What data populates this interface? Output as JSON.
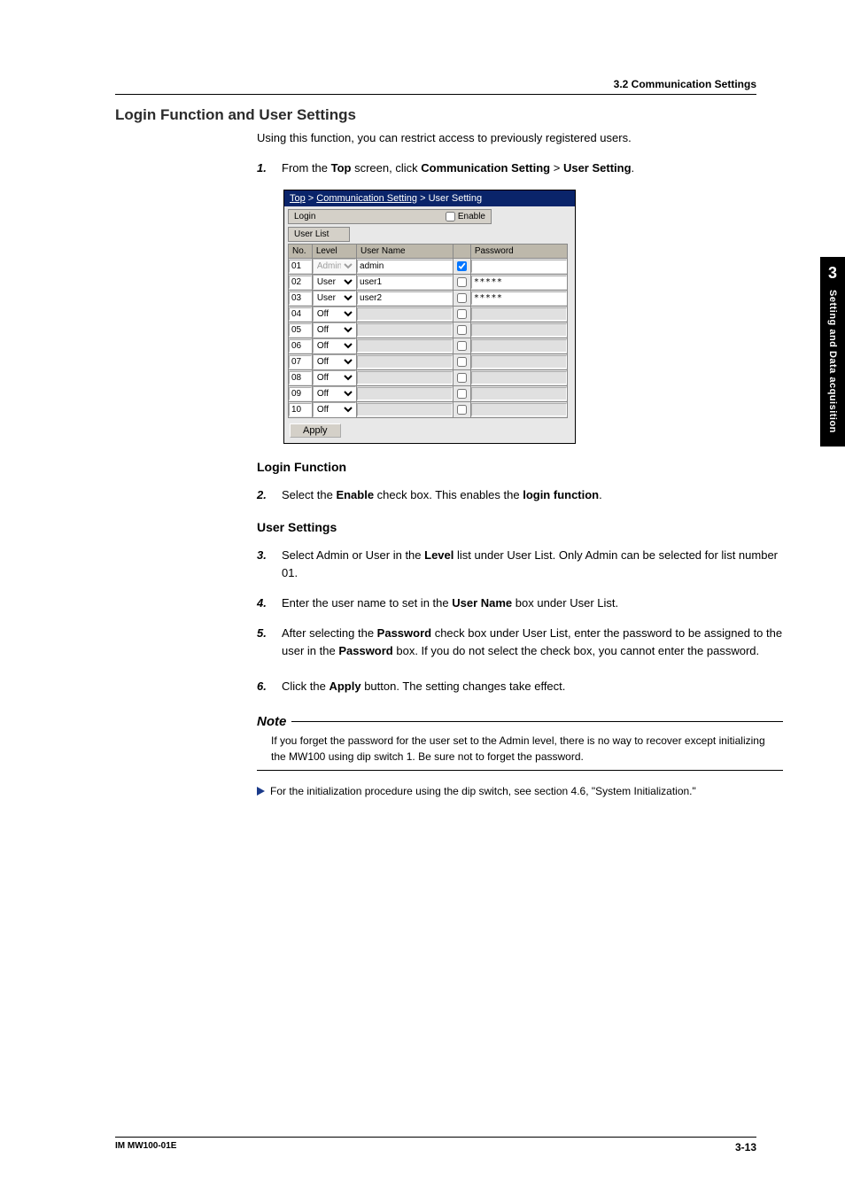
{
  "running_head": "3.2  Communication Settings",
  "h1": "Login Function and User Settings",
  "intro": "Using this function, you can restrict access to previously registered users.",
  "step1_num": "1.",
  "step1_a": "From the ",
  "step1_b": "Top",
  "step1_c": " screen, click ",
  "step1_d": "Communication Setting",
  "step1_e": " > ",
  "step1_f": "User Setting",
  "step1_g": ".",
  "bc_top": "Top",
  "bc_cs": "Communication Setting",
  "bc_us": "User Setting",
  "login_panel": "Login",
  "enable_label": "Enable",
  "userlist_panel": "User List",
  "th_no": "No.",
  "th_level": "Level",
  "th_username": "User Name",
  "th_password": "Password",
  "rows": [
    {
      "no": "01",
      "level": "Admin",
      "un": "admin",
      "chk": true,
      "pw": "",
      "dis": true
    },
    {
      "no": "02",
      "level": "User",
      "un": "user1",
      "chk": false,
      "pw": "*****"
    },
    {
      "no": "03",
      "level": "User",
      "un": "user2",
      "chk": false,
      "pw": "*****"
    },
    {
      "no": "04",
      "level": "Off",
      "un": "",
      "chk": false,
      "pw": ""
    },
    {
      "no": "05",
      "level": "Off",
      "un": "",
      "chk": false,
      "pw": ""
    },
    {
      "no": "06",
      "level": "Off",
      "un": "",
      "chk": false,
      "pw": ""
    },
    {
      "no": "07",
      "level": "Off",
      "un": "",
      "chk": false,
      "pw": ""
    },
    {
      "no": "08",
      "level": "Off",
      "un": "",
      "chk": false,
      "pw": ""
    },
    {
      "no": "09",
      "level": "Off",
      "un": "",
      "chk": false,
      "pw": ""
    },
    {
      "no": "10",
      "level": "Off",
      "un": "",
      "chk": false,
      "pw": ""
    }
  ],
  "apply_btn": "Apply",
  "h2_login": "Login Function",
  "step2_num": "2.",
  "step2_a": "Select the ",
  "step2_b": "Enable",
  "step2_c": " check box. This enables the ",
  "step2_d": "login function",
  "step2_e": ".",
  "h2_user": "User Settings",
  "step3_num": "3.",
  "step3_a": "Select Admin or User in the ",
  "step3_b": "Level",
  "step3_c": " list under User List. Only Admin can be selected for list number 01.",
  "step4_num": "4.",
  "step4_a": "Enter the user name to set in the ",
  "step4_b": "User Name",
  "step4_c": " box under User List.",
  "step5_num": "5.",
  "step5_a": "After selecting the ",
  "step5_b": "Password",
  "step5_c": " check box under User List, enter the password to be assigned to the user in the ",
  "step5_d": "Password",
  "step5_e": " box. If you do not select the check box, you cannot enter the password.",
  "step6_num": "6.",
  "step6_a": "Click the ",
  "step6_b": "Apply",
  "step6_c": " button. The setting changes take effect.",
  "note_label": "Note",
  "note_body": "If you forget the password for the user set to the Admin level, there is no way to recover except initializing the MW100 using dip switch 1. Be sure not to forget the password.",
  "ref_text": "For the initialization procedure using the dip switch, see section 4.6, \"System Initialization.\"",
  "side_chapter": "3",
  "side_title": "Setting and Data acquisition",
  "footer_doc": "IM MW100-01E",
  "footer_page": "3-13"
}
